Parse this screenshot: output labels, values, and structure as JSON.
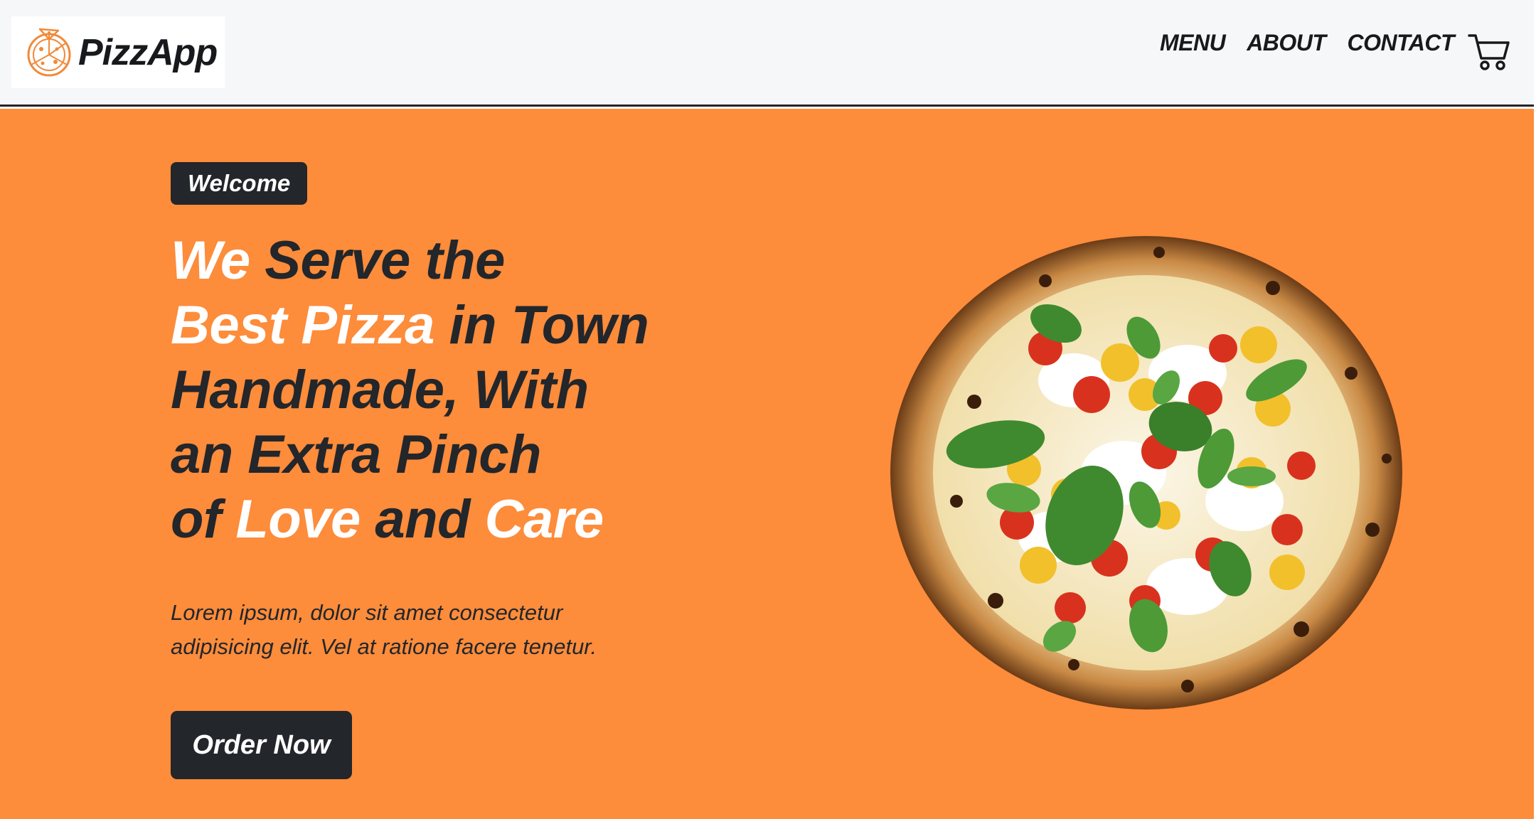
{
  "header": {
    "logo_text": "PizzApp",
    "logo_icon": "pizza-slice-icon",
    "nav": [
      {
        "label": "MENU"
      },
      {
        "label": "ABOUT"
      },
      {
        "label": "CONTACT"
      }
    ],
    "cart_icon": "shopping-cart-icon"
  },
  "hero": {
    "badge": "Welcome",
    "headline": {
      "l1a": "We",
      "l1b": " Serve the",
      "l2a": "Best Pizza",
      "l2b": " in Town",
      "l3": "Handmade, With",
      "l4": "an Extra Pinch",
      "l5a": "of ",
      "l5b": "Love",
      "l5c": " and ",
      "l5d": "Care"
    },
    "description": "Lorem ipsum, dolor sit amet consectetur adipisicing elit. Vel at ratione facere tenetur.",
    "cta_label": "Order Now",
    "image": "pizza-image"
  },
  "colors": {
    "accent": "#fd8c3b",
    "dark": "#23262a",
    "header_bg": "#f6f7f9",
    "text_highlight": "#ffffff"
  }
}
